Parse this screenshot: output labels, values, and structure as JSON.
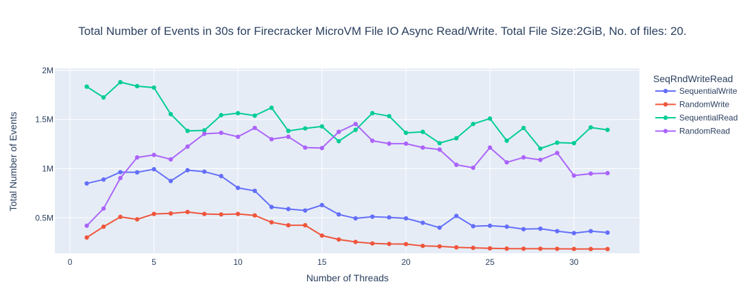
{
  "chart_data": {
    "type": "line",
    "title": "Total Number of Events in 30s for Firecracker MicroVM File IO Async Read/Write. Total File Size:2GiB, No. of files: 20.",
    "xlabel": "Number of Threads",
    "ylabel": "Total Number of Events",
    "xlim": [
      -0.9,
      33.9
    ],
    "ylim": [
      140000,
      2020000
    ],
    "x_ticks": [
      0,
      5,
      10,
      15,
      20,
      25,
      30
    ],
    "y_ticks": [
      500000,
      1000000,
      1500000,
      2000000
    ],
    "y_tick_labels": [
      "0.5M",
      "1M",
      "1.5M",
      "2M"
    ],
    "legend_title": "SeqRndWriteRead",
    "legend_position": "right",
    "grid": true,
    "x": [
      1,
      2,
      3,
      4,
      5,
      6,
      7,
      8,
      9,
      10,
      11,
      12,
      13,
      14,
      15,
      16,
      17,
      18,
      19,
      20,
      21,
      22,
      23,
      24,
      25,
      26,
      27,
      28,
      29,
      30,
      31,
      32
    ],
    "series": [
      {
        "name": "SequentialWrite",
        "color": "#636efa",
        "values": [
          850000,
          890000,
          965000,
          963000,
          995000,
          875000,
          985000,
          970000,
          925000,
          805000,
          775000,
          610000,
          590000,
          575000,
          630000,
          535000,
          495000,
          512000,
          505000,
          495000,
          450000,
          400000,
          520000,
          415000,
          420000,
          410000,
          385000,
          390000,
          365000,
          345000,
          365000,
          350000
        ]
      },
      {
        "name": "RandomWrite",
        "color": "#ef553b",
        "values": [
          300000,
          410000,
          510000,
          485000,
          540000,
          545000,
          560000,
          540000,
          535000,
          540000,
          525000,
          455000,
          425000,
          425000,
          320000,
          280000,
          255000,
          240000,
          235000,
          233000,
          215000,
          210000,
          200000,
          195000,
          190000,
          187000,
          186000,
          186000,
          185000,
          184000,
          183000,
          183000
        ]
      },
      {
        "name": "SequentialRead",
        "color": "#00cc96",
        "values": [
          1835000,
          1725000,
          1880000,
          1840000,
          1825000,
          1555000,
          1385000,
          1390000,
          1545000,
          1565000,
          1540000,
          1620000,
          1385000,
          1410000,
          1430000,
          1280000,
          1395000,
          1565000,
          1535000,
          1365000,
          1375000,
          1260000,
          1310000,
          1455000,
          1510000,
          1285000,
          1415000,
          1205000,
          1265000,
          1260000,
          1420000,
          1395000
        ]
      },
      {
        "name": "RandomRead",
        "color": "#ab63fa",
        "values": [
          420000,
          595000,
          905000,
          1115000,
          1140000,
          1095000,
          1225000,
          1355000,
          1365000,
          1325000,
          1415000,
          1300000,
          1325000,
          1215000,
          1210000,
          1375000,
          1455000,
          1285000,
          1255000,
          1255000,
          1215000,
          1195000,
          1040000,
          1010000,
          1215000,
          1065000,
          1115000,
          1090000,
          1160000,
          930000,
          950000,
          955000
        ]
      }
    ]
  }
}
